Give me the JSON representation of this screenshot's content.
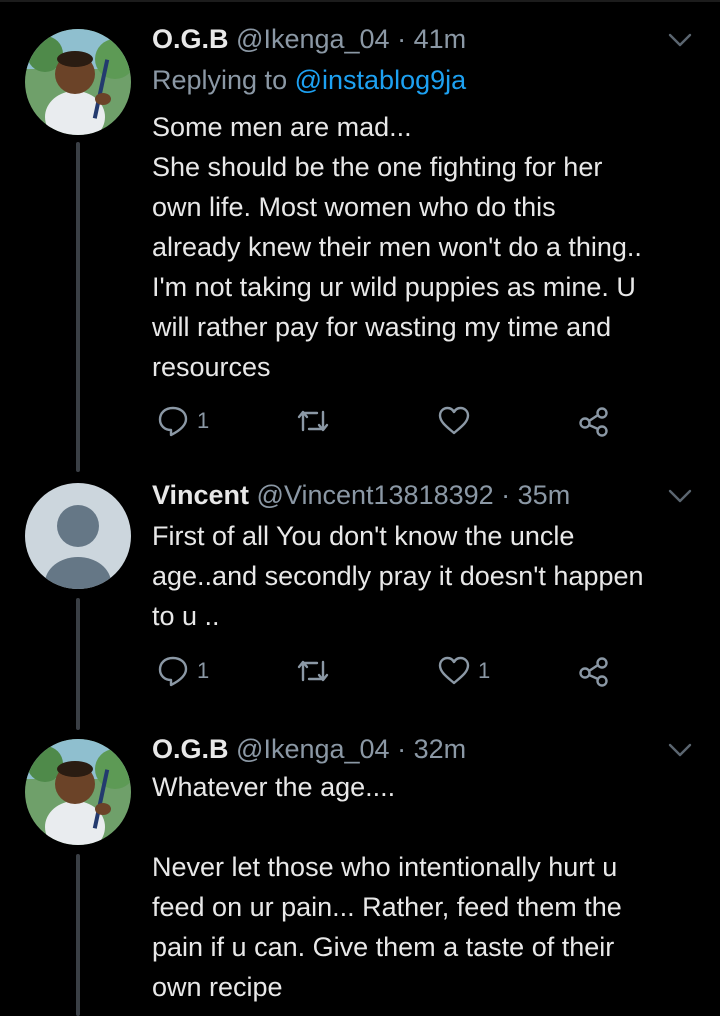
{
  "colors": {
    "background": "#000000",
    "text": "#e8e8e8",
    "muted": "#8b98a5",
    "link": "#1da1f2"
  },
  "tweets": [
    {
      "name": "O.G.B",
      "handle": "@Ikenga_04",
      "time": "· 41m",
      "replying_label": "Replying to",
      "replying_handle": "@instablog9ja",
      "lines": [
        "Some men are mad...",
        "She should be the one fighting for her",
        "own life. Most women who do this",
        "already knew their men won't do a thing..",
        "I'm not taking ur wild puppies as mine. U",
        "will rather pay for wasting my time and",
        "resources"
      ],
      "reply_count": "1",
      "retweet_count": "",
      "like_count": ""
    },
    {
      "name": "Vincent",
      "handle": "@Vincent13818392",
      "time": "· 35m",
      "lines": [
        "First of all You don't know the uncle",
        "age..and secondly pray it doesn't happen",
        "to u .."
      ],
      "reply_count": "1",
      "retweet_count": "",
      "like_count": "1"
    },
    {
      "name": "O.G.B",
      "handle": "@Ikenga_04",
      "time": "· 32m",
      "lines": [
        "Whatever the age....",
        "",
        "Never let those who intentionally hurt u",
        "feed on ur pain... Rather, feed them the",
        "pain if u can. Give them a taste of their",
        "own recipe"
      ]
    }
  ],
  "icons": [
    "reply-icon",
    "retweet-icon",
    "like-icon",
    "share-icon",
    "chevron-down-icon"
  ]
}
